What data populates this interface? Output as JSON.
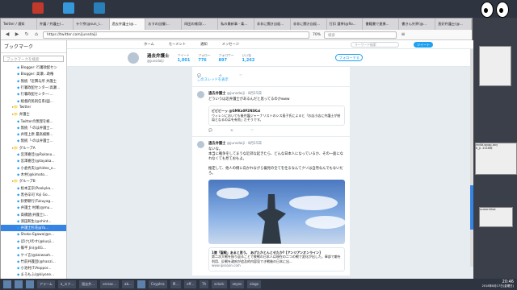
{
  "browser": {
    "tabs": [
      {
        "label": "Twitter / 通知"
      },
      {
        "label": "弁護 / 弁護士(..."
      },
      {
        "label": "ラク京(@sun_l..."
      },
      {
        "label": "過去弁護士(@..."
      },
      {
        "label": "おすの自慢(..."
      },
      {
        "label": "岡田の雑用(..."
      },
      {
        "label": "私の最新事 - 楽..."
      },
      {
        "label": "非非に聞き自殺..."
      },
      {
        "label": "非非に聞き自殺..."
      },
      {
        "label": "打扣 選挙(@Ro..."
      },
      {
        "label": "書籍書で連携..."
      },
      {
        "label": "書きん外界(@..."
      },
      {
        "label": "直好弁護士(@..."
      }
    ],
    "window_title": "過去弁護士(@junsdasi)さん | Twitter - Mozilla Firefox",
    "url": "https://twitter.com/junsdaiji",
    "zoom": "70%",
    "search_placeholder": "検索"
  },
  "sidebar": {
    "title": "ブックマーク",
    "search_placeholder": "ブックマークを検索",
    "items": [
      {
        "label": "Blogger: 行署政配セン"
      },
      {
        "label": "Blogger: 高瀬...政権"
      },
      {
        "label": "無統「近隣与所 弁護士"
      },
      {
        "label": "行署政配センター:高瀬..."
      },
      {
        "label": "行署政配センター:..."
      },
      {
        "label": "総督府民刑信系(図..."
      },
      {
        "label": "Twitter"
      },
      {
        "label": "弁護士"
      },
      {
        "label": "Twitterの無理を極..."
      },
      {
        "label": "無統「-のは弁護士..."
      },
      {
        "label": "弁理上原 最高検察..."
      },
      {
        "label": "無統「-のは弁護士..."
      },
      {
        "label": "グループA"
      },
      {
        "label": "宮澤嘉佳(@Rukasu..."
      },
      {
        "label": "宮澤嘉佳(@tayaka..."
      },
      {
        "label": "小倉秀夫(@hideo_o..."
      },
      {
        "label": "木村(@kimoto..."
      },
      {
        "label": "グループB"
      },
      {
        "label": "松本正宗(Pookyka..."
      },
      {
        "label": "黒谷辛司 Yoji Go..."
      },
      {
        "label": "鈴野耕行(Tukuyag..."
      },
      {
        "label": "弁護士 村尾(@mu..."
      },
      {
        "label": "髙橋健(弁護士)..."
      },
      {
        "label": "渕田和生(@shint..."
      },
      {
        "label": "弁護士杉花@Yu..."
      },
      {
        "label": "Shoko Egawa(@e..."
      },
      {
        "label": "ぼけびのす(@kusji..."
      },
      {
        "label": "篠平 Jin(@0G..."
      },
      {
        "label": "ケイ言(@keiwaah..."
      },
      {
        "label": "竹前弁護団(@hanzi..."
      },
      {
        "label": "小池村(T/Aoppor..."
      },
      {
        "label": "まろもふ(@kiyone..."
      },
      {
        "label": "弁護士ぱくと(@sa..."
      },
      {
        "label": "成田典(JunRuan..."
      },
      {
        "label": "yoboPowbic(Sint..."
      }
    ],
    "selected_index": 24
  },
  "twitter": {
    "nav": [
      "ホーム",
      "モーメント",
      "通知",
      "メッセージ"
    ],
    "search_placeholder": "キーワード検索",
    "tweet_button": "ツイート",
    "profile": {
      "name": "過去弁護士",
      "handle": "@junsdaiji",
      "stats": [
        {
          "label": "ツイート",
          "value": "1,001"
        },
        {
          "label": "フォロー",
          "value": "776"
        },
        {
          "label": "フォロワー",
          "value": "897"
        },
        {
          "label": "いいね",
          "value": "1,262"
        }
      ],
      "follow_button": "フォローする"
    },
    "show_thread": "このスレッドを表示",
    "tweets": [
      {
        "name": "過去弁護士",
        "handle": "@junsdaiji",
        "date": "· 8月15日",
        "text": "どういうは近弁護士があるんだと思ってるのかwww",
        "card_title": "ビビビーッ @GMKa0P2NSKai",
        "card_text": "ウィレンにおいても後弁護ジャーナリストのシス島子氏によると「お店小店に弁護士が結局となるのはを有効」だそうです。",
        "card_url": ""
      },
      {
        "name": "過去弁護士",
        "handle": "@junsdaiji",
        "date": "· 8月15日",
        "text": "ないな。\n本当に戦争をしてまうな近郊な起きたら、どんな日本人になっているか、その一面になれなくても見ておもよ。\n\n推定して、他人の側に向かれながら偏見の全てを仕るなんてクソは自然なんでもないだろ。",
        "card_title": "1億「聖戦」あると思う。 あげたかとんとせたか? [アンジアンオンライン]",
        "card_text": "第二次大戦を振り返ることで敗戦の日本人は現在の二つの戦で変化が出した。軍部で敵を利用、反戦を政府が追及的内容見でき戦後の日本に出...",
        "card_url": "www.ipssoon.com"
      }
    ]
  },
  "taskbar": {
    "items": [
      "",
      "",
      "",
      "アラーム",
      "a_スク...",
      "過去弁...",
      "versac...",
      "ab...",
      "",
      "Ceyphra",
      "Ifl...",
      "eff...",
      "Th",
      "sclock",
      "xeyes",
      "xlogo"
    ],
    "time": "20:46",
    "date": "2018年8月17日(金曜日)"
  },
  "right_panel": {
    "win1": "screenShot",
    "win2": "redid-wyap-any",
    "win3": "K_Ji. 2016年"
  }
}
